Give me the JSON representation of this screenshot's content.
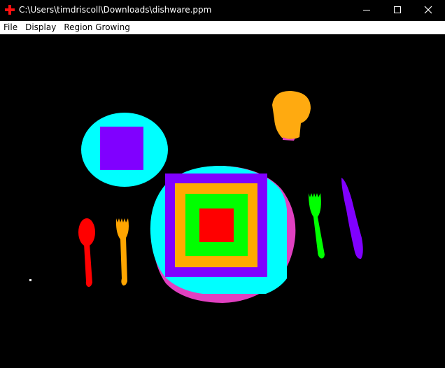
{
  "window": {
    "title": "C:\\Users\\timdriscoll\\Downloads\\dishware.ppm"
  },
  "title_icons": {
    "app": "red-cross-icon",
    "minimize": "minimize-icon",
    "maximize": "maximize-icon",
    "close": "close-icon"
  },
  "menu": {
    "items": [
      {
        "label": "File"
      },
      {
        "label": "Display"
      },
      {
        "label": "Region Growing"
      }
    ]
  },
  "image": {
    "colors": {
      "background": "#000000",
      "cyan": "#00ffff",
      "purple": "#8000ff",
      "orange": "#ffa500",
      "green": "#00ff00",
      "red": "#ff0000",
      "magenta": "#e040c0",
      "white": "#ffffff"
    }
  }
}
